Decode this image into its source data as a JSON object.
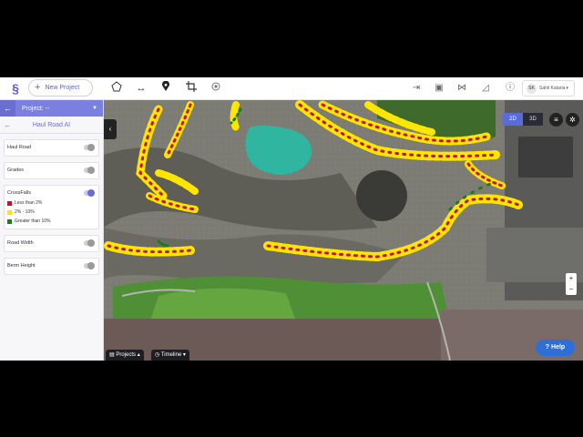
{
  "topbar": {
    "new_project_label": "New Project",
    "tools": [
      "polygon-icon",
      "measure-icon",
      "pin-icon",
      "crop-icon",
      "target-icon"
    ],
    "right_tools": [
      "export-icon",
      "screenshot-icon",
      "share-icon",
      "annotate-icon",
      "info-icon"
    ],
    "user_initials": "SK",
    "user_name": "Sahil Kataria",
    "user_caret": "▾"
  },
  "sidebar": {
    "project_label": "Project: --",
    "section_title": "Haul Road AI",
    "layers": [
      {
        "name": "Haul Road",
        "on": false
      },
      {
        "name": "Grades",
        "on": false
      },
      {
        "name": "CrossFalls",
        "on": true
      },
      {
        "name": "Road Width",
        "on": false
      },
      {
        "name": "Berm Height",
        "on": false
      }
    ],
    "crossfall_legend": [
      {
        "label": "Less than 2%",
        "color": "#c8102e"
      },
      {
        "label": "2% - 10%",
        "color": "#ffe600"
      },
      {
        "label": "Greater than 10%",
        "color": "#1c7a1c"
      }
    ]
  },
  "map": {
    "view_2d": "2D",
    "view_3d": "3D",
    "zoom_in": "+",
    "zoom_out": "−"
  },
  "bottom": {
    "projects_label": "Projects",
    "timeline_label": "Timeline",
    "help_label": "Help"
  }
}
